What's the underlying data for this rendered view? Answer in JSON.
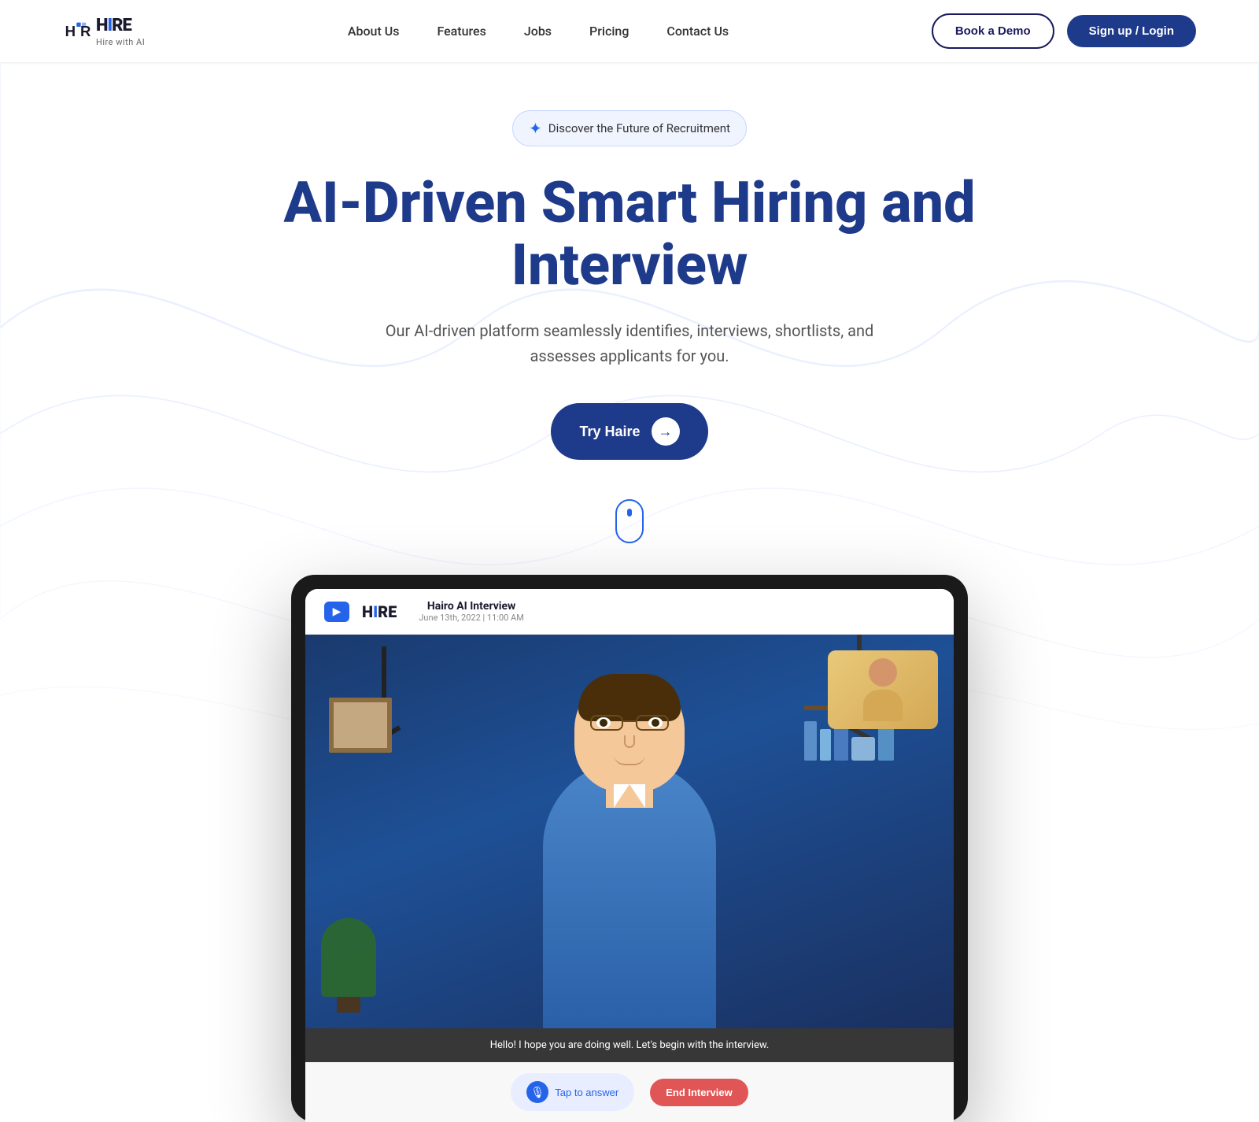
{
  "brand": {
    "name": "HIRE",
    "tagline": "Hire with AI",
    "logo_letters": "H RE"
  },
  "nav": {
    "links": [
      {
        "label": "About Us",
        "id": "about"
      },
      {
        "label": "Features",
        "id": "features"
      },
      {
        "label": "Jobs",
        "id": "jobs"
      },
      {
        "label": "Pricing",
        "id": "pricing"
      },
      {
        "label": "Contact Us",
        "id": "contact"
      }
    ],
    "book_demo": "Book a Demo",
    "sign_up": "Sign up / Login"
  },
  "hero": {
    "badge": "Discover the Future of Recruitment",
    "title": "AI-Driven Smart Hiring and Interview",
    "subtitle": "Our AI-driven platform seamlessly identifies, interviews, shortlists, and assesses applicants for you.",
    "cta": "Try Haire"
  },
  "tablet": {
    "interview_title": "Hairo AI Interview",
    "interview_date": "June 13th, 2022 | 11:00 AM",
    "logo": "H RE",
    "caption": "Hello! I hope you are doing well. Let's begin with the interview.",
    "tap_answer": "Tap to answer",
    "end_interview": "End Interview"
  },
  "colors": {
    "primary": "#1e3a8a",
    "accent": "#2563eb",
    "badge_bg": "#f0f4ff",
    "demo_border": "#1a1a5e",
    "signup_bg": "#1e3a8a"
  }
}
